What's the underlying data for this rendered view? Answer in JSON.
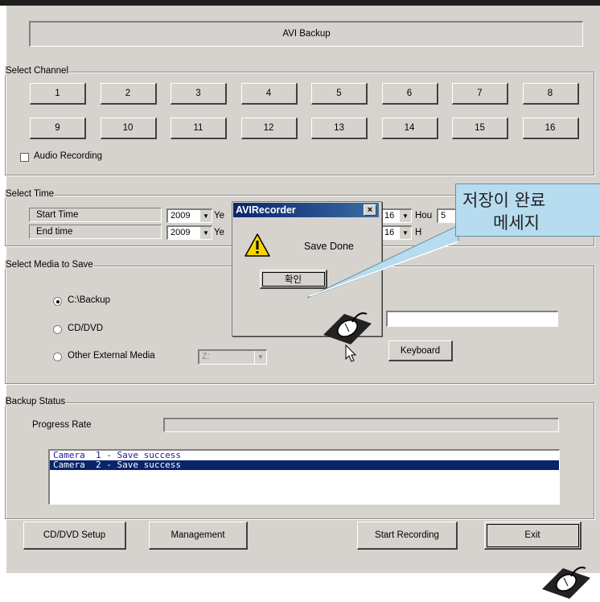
{
  "window": {
    "title": "AVI Backup"
  },
  "select_channel": {
    "legend": "Select Channel",
    "channels": [
      "1",
      "2",
      "3",
      "4",
      "5",
      "6",
      "7",
      "8",
      "9",
      "10",
      "11",
      "12",
      "13",
      "14",
      "15",
      "16"
    ],
    "audio_recording": {
      "label": "Audio Recording",
      "checked": false
    }
  },
  "select_time": {
    "legend": "Select Time",
    "start": {
      "label": "Start Time",
      "year": "2009",
      "year_unit": "Ye",
      "hour": "16",
      "hour_unit": "Hou",
      "minute": "5"
    },
    "end": {
      "label": "End time",
      "year": "2009",
      "year_unit": "Ye",
      "hour": "16",
      "hour_unit": "H"
    }
  },
  "select_media": {
    "legend": "Select Media to Save",
    "options": [
      {
        "label": "C:\\Backup",
        "selected": true
      },
      {
        "label": "CD/DVD",
        "selected": false
      },
      {
        "label": "Other External Media",
        "selected": false
      }
    ],
    "drive": "Z:",
    "keyboard_button": "Keyboard",
    "path_value": ""
  },
  "backup_status": {
    "legend": "Backup Status",
    "progress_label": "Progress Rate",
    "progress": 0,
    "log": [
      {
        "text": "Camera  1 - Save success",
        "selected": false
      },
      {
        "text": "Camera  2 - Save success",
        "selected": true
      }
    ]
  },
  "footer": {
    "cd_dvd_setup": "CD/DVD Setup",
    "management": "Management",
    "start_recording": "Start Recording",
    "exit": "Exit"
  },
  "dialog": {
    "title": "AVIRecorder",
    "message": "Save Done",
    "ok": "확인",
    "close": "×"
  },
  "callout": {
    "line1": "저장이 완료",
    "line2": "메세지"
  },
  "colors": {
    "panel": "#d6d3ce",
    "selection": "#0a246a",
    "callout": "#b7dcef"
  }
}
